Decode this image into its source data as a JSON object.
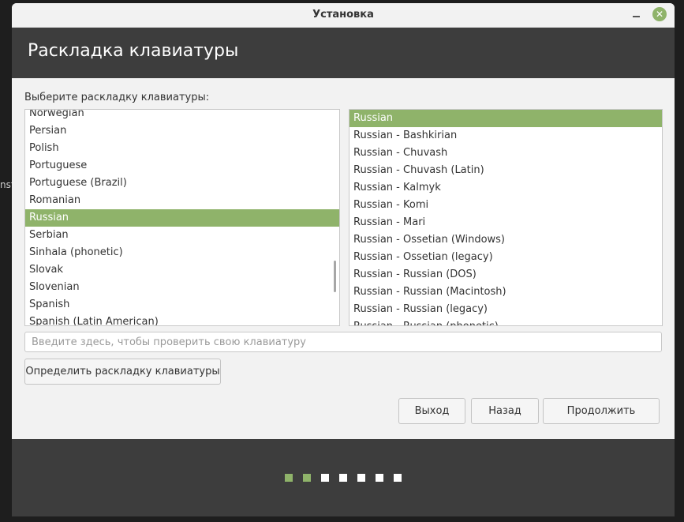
{
  "window": {
    "title": "Установка",
    "close_glyph": "✕"
  },
  "background_fragment": "nst",
  "header": {
    "title": "Раскладка клавиатуры"
  },
  "prompt": "Выберите раскладку клавиатуры:",
  "layouts": [
    {
      "label": "Norwegian",
      "selected": false
    },
    {
      "label": "Persian",
      "selected": false
    },
    {
      "label": "Polish",
      "selected": false
    },
    {
      "label": "Portuguese",
      "selected": false
    },
    {
      "label": "Portuguese (Brazil)",
      "selected": false
    },
    {
      "label": "Romanian",
      "selected": false
    },
    {
      "label": "Russian",
      "selected": true
    },
    {
      "label": "Serbian",
      "selected": false
    },
    {
      "label": "Sinhala (phonetic)",
      "selected": false
    },
    {
      "label": "Slovak",
      "selected": false
    },
    {
      "label": "Slovenian",
      "selected": false
    },
    {
      "label": "Spanish",
      "selected": false
    },
    {
      "label": "Spanish (Latin American)",
      "selected": false
    }
  ],
  "variants": [
    {
      "label": "Russian",
      "selected": true
    },
    {
      "label": "Russian - Bashkirian",
      "selected": false
    },
    {
      "label": "Russian - Chuvash",
      "selected": false
    },
    {
      "label": "Russian - Chuvash (Latin)",
      "selected": false
    },
    {
      "label": "Russian - Kalmyk",
      "selected": false
    },
    {
      "label": "Russian - Komi",
      "selected": false
    },
    {
      "label": "Russian - Mari",
      "selected": false
    },
    {
      "label": "Russian - Ossetian (Windows)",
      "selected": false
    },
    {
      "label": "Russian - Ossetian (legacy)",
      "selected": false
    },
    {
      "label": "Russian - Russian (DOS)",
      "selected": false
    },
    {
      "label": "Russian - Russian (Macintosh)",
      "selected": false
    },
    {
      "label": "Russian - Russian (legacy)",
      "selected": false
    },
    {
      "label": "Russian - Russian (phonetic)",
      "selected": false
    }
  ],
  "test_input": {
    "placeholder": "Введите здесь, чтобы проверить свою клавиатуру",
    "value": ""
  },
  "buttons": {
    "detect": "Определить раскладку клавиатуры",
    "quit": "Выход",
    "back": "Назад",
    "continue": "Продолжить"
  },
  "progress": {
    "total_steps": 7,
    "completed_steps": 2
  },
  "colors": {
    "accent": "#8fb36a",
    "header": "#3d3d3d"
  }
}
